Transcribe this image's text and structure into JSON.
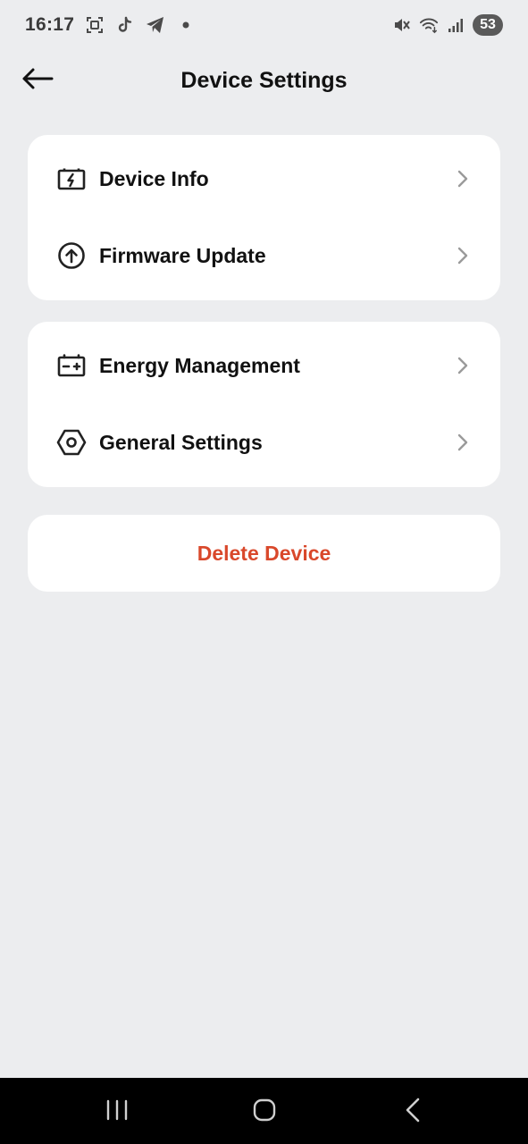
{
  "status_bar": {
    "time": "16:17",
    "battery": "53",
    "icons": [
      "screenshot-icon",
      "tiktok-icon",
      "telegram-icon",
      "notification-dot-icon",
      "mute-icon",
      "wifi-icon",
      "signal-icon"
    ]
  },
  "header": {
    "title": "Device Settings",
    "back_icon": "arrow-left-icon"
  },
  "groups": [
    {
      "items": [
        {
          "label": "Device Info",
          "icon": "battery-charging-icon"
        },
        {
          "label": "Firmware Update",
          "icon": "upload-circle-icon"
        }
      ]
    },
    {
      "items": [
        {
          "label": "Energy Management",
          "icon": "battery-plus-minus-icon"
        },
        {
          "label": "General Settings",
          "icon": "hex-settings-icon"
        }
      ]
    }
  ],
  "delete": {
    "label": "Delete Device",
    "color": "#d9482b"
  },
  "nav_bar": {
    "icons": [
      "recents-icon",
      "home-icon",
      "back-icon"
    ]
  }
}
